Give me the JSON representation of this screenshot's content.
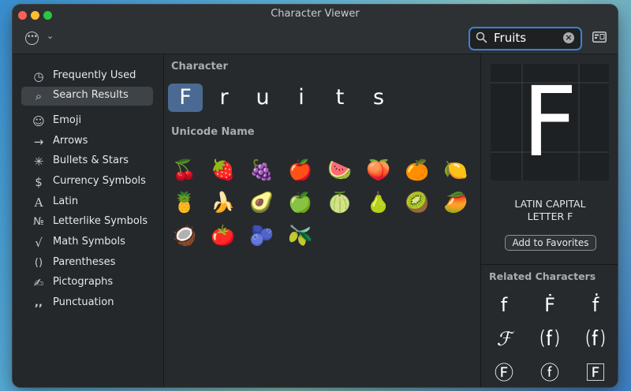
{
  "window": {
    "title": "Character Viewer"
  },
  "search": {
    "value": "Fruits"
  },
  "sidebar": {
    "items": [
      {
        "label": "Frequently Used",
        "icon": "◷"
      },
      {
        "label": "Search Results",
        "icon": "⌕"
      },
      {
        "label": "Emoji",
        "icon": "☺"
      },
      {
        "label": "Arrows",
        "icon": "→"
      },
      {
        "label": "Bullets & Stars",
        "icon": "✳"
      },
      {
        "label": "Currency Symbols",
        "icon": "$"
      },
      {
        "label": "Latin",
        "icon": "A"
      },
      {
        "label": "Letterlike Symbols",
        "icon": "№"
      },
      {
        "label": "Math Symbols",
        "icon": "√"
      },
      {
        "label": "Parentheses",
        "icon": "()"
      },
      {
        "label": "Pictographs",
        "icon": "✍"
      },
      {
        "label": "Punctuation",
        "icon": ",,"
      }
    ]
  },
  "main": {
    "character_label": "Character",
    "unicode_label": "Unicode Name",
    "characters": [
      "F",
      "r",
      "u",
      "i",
      "t",
      "s"
    ],
    "emoji": [
      "🍒",
      "🍓",
      "🍇",
      "🍎",
      "🍉",
      "🍑",
      "🍊",
      "🍋",
      "🍍",
      "🍌",
      "🥑",
      "🍏",
      "🍈",
      "🍐",
      "🥝",
      "🥭",
      "🥥",
      "🍅",
      "🫐",
      "🫒"
    ]
  },
  "detail": {
    "glyph": "F",
    "name_line1": "LATIN CAPITAL",
    "name_line2": "LETTER F",
    "favorites_label": "Add to Favorites",
    "related_label": "Related Characters",
    "related": [
      "f",
      "Ḟ",
      "ḟ",
      "ℱ",
      "⒡",
      "⒡",
      "Ⓕ",
      "ⓕ",
      "🄵"
    ]
  }
}
